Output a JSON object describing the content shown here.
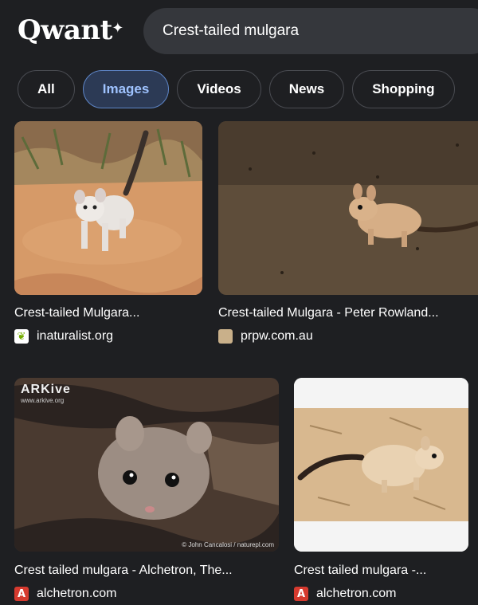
{
  "header": {
    "logo": "Qwant",
    "search_value": "Crest-tailed mulgara"
  },
  "tabs": [
    {
      "label": "All",
      "active": false
    },
    {
      "label": "Images",
      "active": true
    },
    {
      "label": "Videos",
      "active": false
    },
    {
      "label": "News",
      "active": false
    },
    {
      "label": "Shopping",
      "active": false
    }
  ],
  "results": [
    {
      "title": "Crest-tailed Mulgara...",
      "source": "inaturalist.org",
      "favicon": "inaturalist-leaf-icon"
    },
    {
      "title": "Crest-tailed Mulgara - Peter Rowland...",
      "source": "prpw.com.au",
      "favicon": "prpw-photo-icon"
    },
    {
      "title": "Crest tailed mulgara - Alchetron, The...",
      "source": "alchetron.com",
      "favicon": "alchetron-a-icon",
      "watermark": "ARKive",
      "watermark_url": "www.arkive.org",
      "credit": "© John Cancalosi / naturepl.com"
    },
    {
      "title": "Crest tailed mulgara -...",
      "source": "alchetron.com",
      "favicon": "alchetron-a-icon"
    }
  ],
  "colors": {
    "background": "#1e1f22",
    "active_tab_bg": "#2c3a55",
    "active_tab_text": "#9fc3ff"
  }
}
